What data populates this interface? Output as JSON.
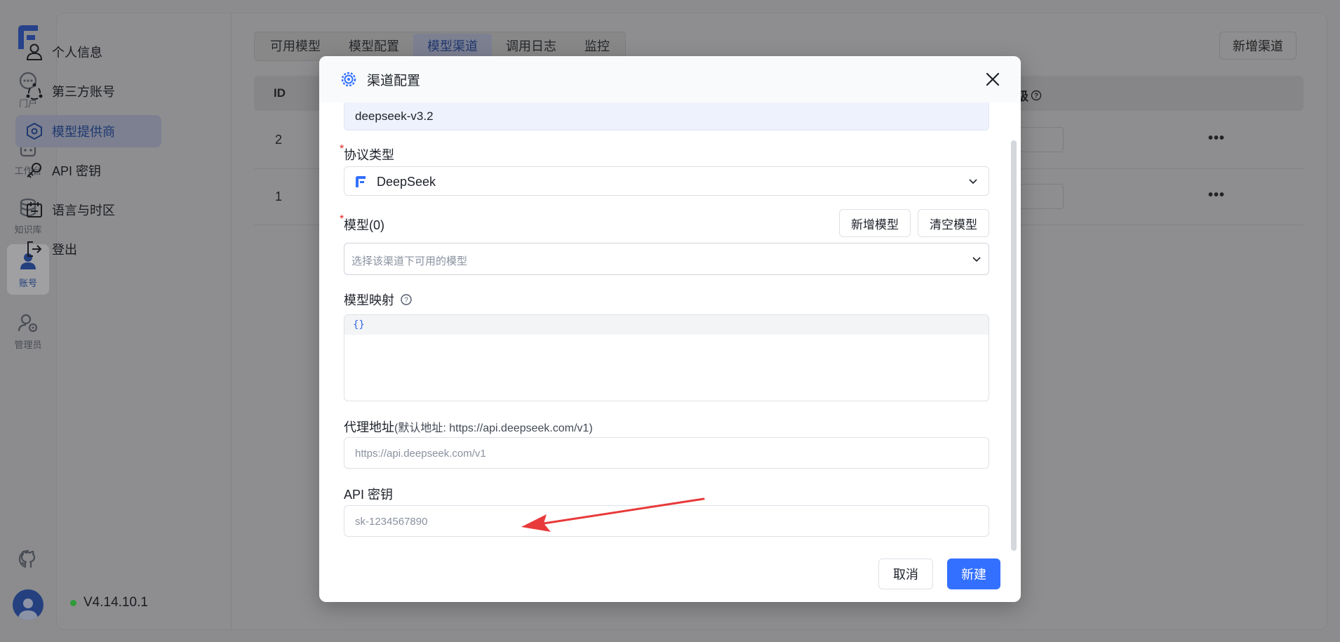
{
  "rail": {
    "items": [
      {
        "label": "门户",
        "icon": "chat-bubble-icon"
      },
      {
        "label": "工作台",
        "icon": "robot-icon"
      },
      {
        "label": "知识库",
        "icon": "database-icon"
      },
      {
        "label": "账号",
        "icon": "user-icon",
        "active": true
      },
      {
        "label": "管理员",
        "icon": "admin-user-icon"
      }
    ]
  },
  "subnav": {
    "items": [
      {
        "label": "个人信息",
        "icon": "person-icon"
      },
      {
        "label": "第三方账号",
        "icon": "connections-icon"
      },
      {
        "label": "模型提供商",
        "icon": "model-provider-icon",
        "active": true
      },
      {
        "label": "API 密钥",
        "icon": "key-icon"
      },
      {
        "label": "语言与时区",
        "icon": "calendar-icon"
      },
      {
        "label": "登出",
        "icon": "logout-icon"
      }
    ],
    "version": "V4.14.10.1"
  },
  "tabs": [
    "可用模型",
    "模型配置",
    "模型渠道",
    "调用日志",
    "监控"
  ],
  "active_tab": "模型渠道",
  "add_channel_label": "新增渠道",
  "table": {
    "header_id": "ID",
    "header_priority_partial": "级",
    "rows": [
      {
        "id": "2"
      },
      {
        "id": "1"
      }
    ]
  },
  "modal": {
    "title": "渠道配置",
    "prev_field_value": "deepseek-v3.2",
    "protocol": {
      "label": "协议类型",
      "value": "DeepSeek"
    },
    "models": {
      "label": "模型(0)",
      "add_label": "新增模型",
      "clear_label": "清空模型",
      "placeholder": "选择该渠道下可用的模型"
    },
    "mapping": {
      "label": "模型映射",
      "value": "{}"
    },
    "proxy": {
      "label": "代理地址",
      "hint": "(默认地址: https://api.deepseek.com/v1)",
      "placeholder": "https://api.deepseek.com/v1"
    },
    "api_key": {
      "label": "API 密钥",
      "placeholder": "sk-1234567890"
    },
    "cancel_label": "取消",
    "create_label": "新建"
  },
  "colors": {
    "accent": "#3370ff",
    "annotation_arrow": "#e83a3a"
  }
}
